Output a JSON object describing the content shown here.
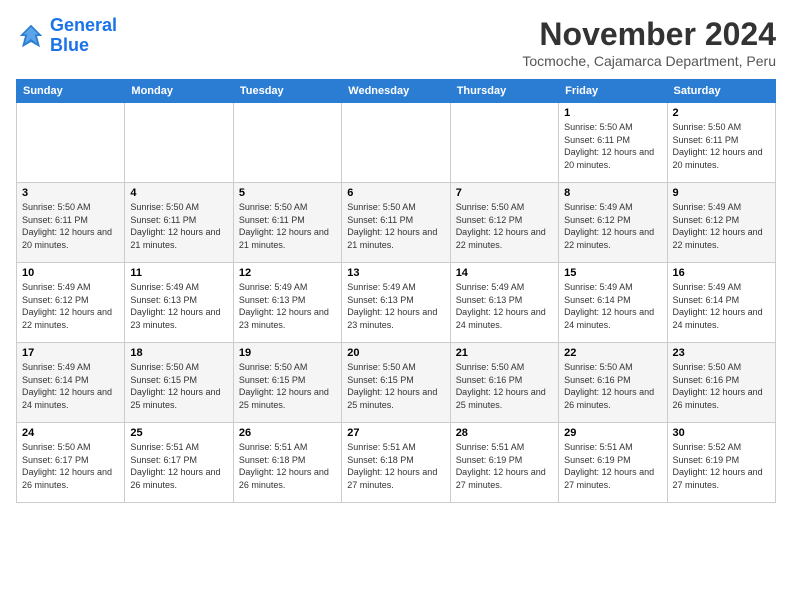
{
  "logo": {
    "line1": "General",
    "line2": "Blue"
  },
  "title": "November 2024",
  "location": "Tocmoche, Cajamarca Department, Peru",
  "weekdays": [
    "Sunday",
    "Monday",
    "Tuesday",
    "Wednesday",
    "Thursday",
    "Friday",
    "Saturday"
  ],
  "weeks": [
    [
      {
        "day": "",
        "info": ""
      },
      {
        "day": "",
        "info": ""
      },
      {
        "day": "",
        "info": ""
      },
      {
        "day": "",
        "info": ""
      },
      {
        "day": "",
        "info": ""
      },
      {
        "day": "1",
        "info": "Sunrise: 5:50 AM\nSunset: 6:11 PM\nDaylight: 12 hours and 20 minutes."
      },
      {
        "day": "2",
        "info": "Sunrise: 5:50 AM\nSunset: 6:11 PM\nDaylight: 12 hours and 20 minutes."
      }
    ],
    [
      {
        "day": "3",
        "info": "Sunrise: 5:50 AM\nSunset: 6:11 PM\nDaylight: 12 hours and 20 minutes."
      },
      {
        "day": "4",
        "info": "Sunrise: 5:50 AM\nSunset: 6:11 PM\nDaylight: 12 hours and 21 minutes."
      },
      {
        "day": "5",
        "info": "Sunrise: 5:50 AM\nSunset: 6:11 PM\nDaylight: 12 hours and 21 minutes."
      },
      {
        "day": "6",
        "info": "Sunrise: 5:50 AM\nSunset: 6:11 PM\nDaylight: 12 hours and 21 minutes."
      },
      {
        "day": "7",
        "info": "Sunrise: 5:50 AM\nSunset: 6:12 PM\nDaylight: 12 hours and 22 minutes."
      },
      {
        "day": "8",
        "info": "Sunrise: 5:49 AM\nSunset: 6:12 PM\nDaylight: 12 hours and 22 minutes."
      },
      {
        "day": "9",
        "info": "Sunrise: 5:49 AM\nSunset: 6:12 PM\nDaylight: 12 hours and 22 minutes."
      }
    ],
    [
      {
        "day": "10",
        "info": "Sunrise: 5:49 AM\nSunset: 6:12 PM\nDaylight: 12 hours and 22 minutes."
      },
      {
        "day": "11",
        "info": "Sunrise: 5:49 AM\nSunset: 6:13 PM\nDaylight: 12 hours and 23 minutes."
      },
      {
        "day": "12",
        "info": "Sunrise: 5:49 AM\nSunset: 6:13 PM\nDaylight: 12 hours and 23 minutes."
      },
      {
        "day": "13",
        "info": "Sunrise: 5:49 AM\nSunset: 6:13 PM\nDaylight: 12 hours and 23 minutes."
      },
      {
        "day": "14",
        "info": "Sunrise: 5:49 AM\nSunset: 6:13 PM\nDaylight: 12 hours and 24 minutes."
      },
      {
        "day": "15",
        "info": "Sunrise: 5:49 AM\nSunset: 6:14 PM\nDaylight: 12 hours and 24 minutes."
      },
      {
        "day": "16",
        "info": "Sunrise: 5:49 AM\nSunset: 6:14 PM\nDaylight: 12 hours and 24 minutes."
      }
    ],
    [
      {
        "day": "17",
        "info": "Sunrise: 5:49 AM\nSunset: 6:14 PM\nDaylight: 12 hours and 24 minutes."
      },
      {
        "day": "18",
        "info": "Sunrise: 5:50 AM\nSunset: 6:15 PM\nDaylight: 12 hours and 25 minutes."
      },
      {
        "day": "19",
        "info": "Sunrise: 5:50 AM\nSunset: 6:15 PM\nDaylight: 12 hours and 25 minutes."
      },
      {
        "day": "20",
        "info": "Sunrise: 5:50 AM\nSunset: 6:15 PM\nDaylight: 12 hours and 25 minutes."
      },
      {
        "day": "21",
        "info": "Sunrise: 5:50 AM\nSunset: 6:16 PM\nDaylight: 12 hours and 25 minutes."
      },
      {
        "day": "22",
        "info": "Sunrise: 5:50 AM\nSunset: 6:16 PM\nDaylight: 12 hours and 26 minutes."
      },
      {
        "day": "23",
        "info": "Sunrise: 5:50 AM\nSunset: 6:16 PM\nDaylight: 12 hours and 26 minutes."
      }
    ],
    [
      {
        "day": "24",
        "info": "Sunrise: 5:50 AM\nSunset: 6:17 PM\nDaylight: 12 hours and 26 minutes."
      },
      {
        "day": "25",
        "info": "Sunrise: 5:51 AM\nSunset: 6:17 PM\nDaylight: 12 hours and 26 minutes."
      },
      {
        "day": "26",
        "info": "Sunrise: 5:51 AM\nSunset: 6:18 PM\nDaylight: 12 hours and 26 minutes."
      },
      {
        "day": "27",
        "info": "Sunrise: 5:51 AM\nSunset: 6:18 PM\nDaylight: 12 hours and 27 minutes."
      },
      {
        "day": "28",
        "info": "Sunrise: 5:51 AM\nSunset: 6:19 PM\nDaylight: 12 hours and 27 minutes."
      },
      {
        "day": "29",
        "info": "Sunrise: 5:51 AM\nSunset: 6:19 PM\nDaylight: 12 hours and 27 minutes."
      },
      {
        "day": "30",
        "info": "Sunrise: 5:52 AM\nSunset: 6:19 PM\nDaylight: 12 hours and 27 minutes."
      }
    ]
  ]
}
